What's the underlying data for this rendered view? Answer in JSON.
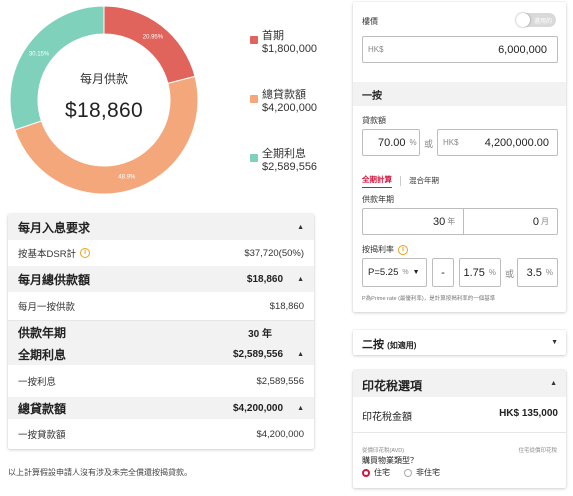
{
  "donut": {
    "center_label": "每月供款",
    "center_value": "$18,860",
    "slices": [
      {
        "name": "首期",
        "percent": 20.95,
        "percent_label": "20.95%",
        "color": "#e0635c"
      },
      {
        "name": "總貸款額",
        "percent": 48.9,
        "percent_label": "48.9%",
        "color": "#f4a77a"
      },
      {
        "name": "全期利息",
        "percent": 30.15,
        "percent_label": "30.15%",
        "color": "#7fd1bb"
      }
    ]
  },
  "legend": [
    {
      "label": "首期",
      "amount": "$1,800,000",
      "color": "#e0635c"
    },
    {
      "label": "總貸款額",
      "amount": "$4,200,000",
      "color": "#f4a77a"
    },
    {
      "label": "全期利息",
      "amount": "$2,589,556",
      "color": "#7fd1bb"
    }
  ],
  "summary": {
    "income_title": "每月入息要求",
    "dsr_label": "按基本DSR計",
    "dsr_value": "$37,720(50%)",
    "total_monthly_title": "每月總供款額",
    "total_monthly_value": "$18,860",
    "first_monthly_label": "每月一按供款",
    "first_monthly_value": "$18,860",
    "tenor_title": "供款年期",
    "tenor_value": "30 年",
    "interest_title": "全期利息",
    "interest_value": "$2,589,556",
    "first_interest_label": "一按利息",
    "first_interest_value": "$2,589,556",
    "loan_title": "總貸款額",
    "loan_value": "$4,200,000",
    "first_loan_label": "一按貸款額",
    "first_loan_value": "$4,200,000"
  },
  "footnote": "以上計算假設申請人沒有涉及未完全償還按揭貸款。",
  "form": {
    "price_label": "樓價",
    "toggle_label": "選用的",
    "price_prefix": "HK$",
    "price_value": "6,000,000",
    "first_mortgage_title": "一按",
    "loan_amount_label": "貸款額",
    "loan_pct_value": "70.00",
    "pct_suffix": "%",
    "or_label": "或",
    "loan_prefix": "HK$",
    "loan_amount_value": "4,200,000.00",
    "tab_active": "全期計算",
    "tab_inactive": "混合年期",
    "tenor_label": "供款年期",
    "tenor_years": "30",
    "years_suffix": "年",
    "tenor_months": "0",
    "months_suffix": "月",
    "rate_label": "按揭利率",
    "rate_base": "P=5.25",
    "rate_pct_suffix": "%",
    "minus": "-",
    "rate_discount": "1.75",
    "rate_final": "3.5",
    "note": "P為Prime rate (最優利率)，是計算按揭利率的一個基準"
  },
  "second_mortgage": {
    "title": "二按",
    "subtitle": "(如適用)"
  },
  "stamp_duty": {
    "title": "印花稅選項",
    "amount_label": "印花稅金額",
    "amount_value": "HK$ 135,000",
    "sub_left": "從價印花稅(AVD)",
    "sub_right": "住宅從價印花稅",
    "question": "購買物業類型？",
    "option_on": "住宅",
    "option_off": "非住宅"
  }
}
